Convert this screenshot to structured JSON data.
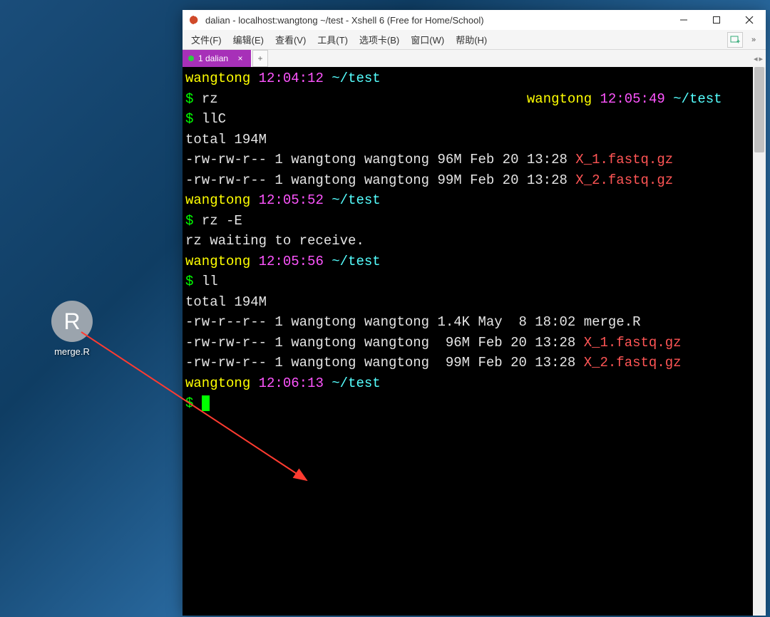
{
  "desktop_icon": {
    "letter": "R",
    "label": "merge.R"
  },
  "window": {
    "title": "dalian - localhost:wangtong ~/test - Xshell 6 (Free for Home/School)"
  },
  "menu": {
    "file": "文件(F)",
    "edit": "编辑(E)",
    "view": "查看(V)",
    "tools": "工具(T)",
    "tabs": "选项卡(B)",
    "window": "窗口(W)",
    "help": "帮助(H)"
  },
  "tab": {
    "label": "1 dalian"
  },
  "term": {
    "prompt1": {
      "user": "wangtong",
      "time": "12:04:12",
      "path": "~/test"
    },
    "cmd1": "rz",
    "r_align": {
      "user": "wangtong",
      "time": "12:05:49",
      "path": "~/test"
    },
    "cmd2": "llC",
    "total1": "total 194M",
    "ls1a": "-rw-rw-r-- 1 wangtong wangtong 96M Feb 20 13:28 ",
    "ls1a_file": "X_1.fastq.gz",
    "ls1b": "-rw-rw-r-- 1 wangtong wangtong 99M Feb 20 13:28 ",
    "ls1b_file": "X_2.fastq.gz",
    "prompt2": {
      "user": "wangtong",
      "time": "12:05:52",
      "path": "~/test"
    },
    "cmd3": "rz -E",
    "rz_wait": "rz waiting to receive.",
    "prompt3": {
      "user": "wangtong",
      "time": "12:05:56",
      "path": "~/test"
    },
    "cmd4": "ll",
    "total2": "total 194M",
    "ls2a": "-rw-r--r-- 1 wangtong wangtong 1.4K May  8 18:02 merge.R",
    "ls2b": "-rw-rw-r-- 1 wangtong wangtong  96M Feb 20 13:28 ",
    "ls2b_file": "X_1.fastq.gz",
    "ls2c": "-rw-rw-r-- 1 wangtong wangtong  99M Feb 20 13:28 ",
    "ls2c_file": "X_2.fastq.gz",
    "prompt4": {
      "user": "wangtong",
      "time": "12:06:13",
      "path": "~/test"
    },
    "dollar": "$ "
  }
}
